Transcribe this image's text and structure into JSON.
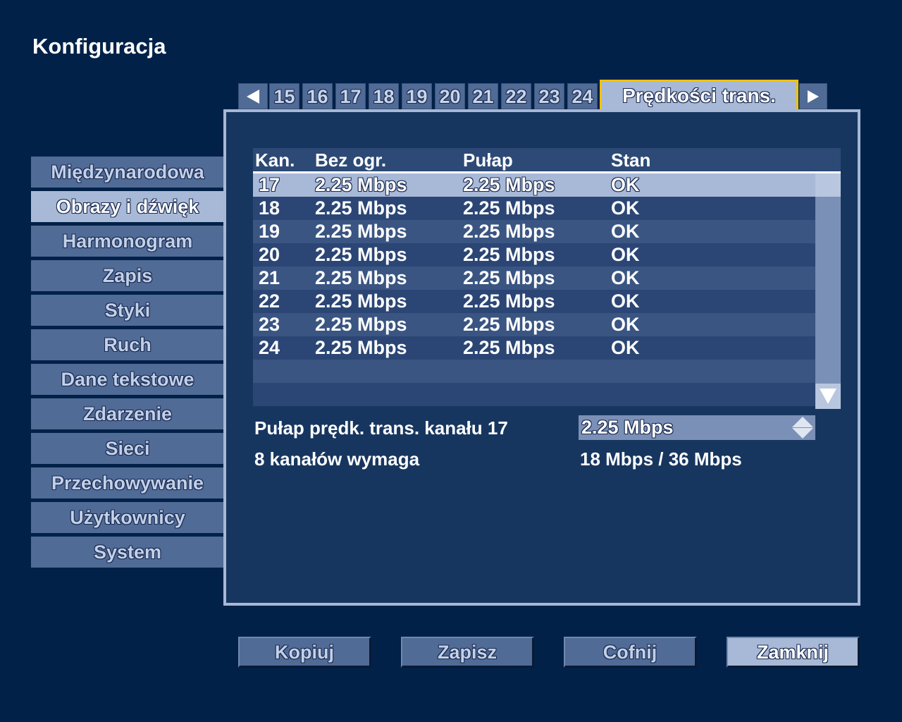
{
  "page": {
    "title": "Konfiguracja"
  },
  "tabs": {
    "numbers": [
      "15",
      "16",
      "17",
      "18",
      "19",
      "20",
      "21",
      "22",
      "23",
      "24"
    ],
    "active_label": "Prędkości trans.",
    "prev_icon": "triangle-left-icon",
    "next_icon": "triangle-right-icon"
  },
  "sidebar": {
    "items": [
      {
        "label": "Międzynarodowa",
        "selected": false
      },
      {
        "label": "Obrazy i dźwięk",
        "selected": true
      },
      {
        "label": "Harmonogram",
        "selected": false
      },
      {
        "label": "Zapis",
        "selected": false
      },
      {
        "label": "Styki",
        "selected": false
      },
      {
        "label": "Ruch",
        "selected": false
      },
      {
        "label": "Dane tekstowe",
        "selected": false
      },
      {
        "label": "Zdarzenie",
        "selected": false
      },
      {
        "label": "Sieci",
        "selected": false
      },
      {
        "label": "Przechowywanie",
        "selected": false
      },
      {
        "label": "Użytkownicy",
        "selected": false
      },
      {
        "label": "System",
        "selected": false
      }
    ]
  },
  "table": {
    "headers": [
      "Kan.",
      "Bez ogr.",
      "Pułap",
      "Stan"
    ],
    "rows": [
      [
        "17",
        "2.25 Mbps",
        "2.25 Mbps",
        "OK"
      ],
      [
        "18",
        "2.25 Mbps",
        "2.25 Mbps",
        "OK"
      ],
      [
        "19",
        "2.25 Mbps",
        "2.25 Mbps",
        "OK"
      ],
      [
        "20",
        "2.25 Mbps",
        "2.25 Mbps",
        "OK"
      ],
      [
        "21",
        "2.25 Mbps",
        "2.25 Mbps",
        "OK"
      ],
      [
        "22",
        "2.25 Mbps",
        "2.25 Mbps",
        "OK"
      ],
      [
        "23",
        "2.25 Mbps",
        "2.25 Mbps",
        "OK"
      ],
      [
        "24",
        "2.25 Mbps",
        "2.25 Mbps",
        "OK"
      ]
    ],
    "selected_row": 0,
    "empty_rows": 2
  },
  "settings": {
    "limit_label": "Pułap prędk. trans. kanału 17",
    "limit_value": "2.25 Mbps",
    "requires_label": "8 kanałów wymaga",
    "requires_value": "18 Mbps / 36 Mbps"
  },
  "buttons": {
    "copy": "Kopiuj",
    "save": "Zapisz",
    "undo": "Cofnij",
    "close": "Zamknij"
  },
  "colors": {
    "background": "#012148",
    "panel": "#17365f",
    "item": "#506b96",
    "selected": "#a8b9d8",
    "focus_border": "#f2c200"
  }
}
